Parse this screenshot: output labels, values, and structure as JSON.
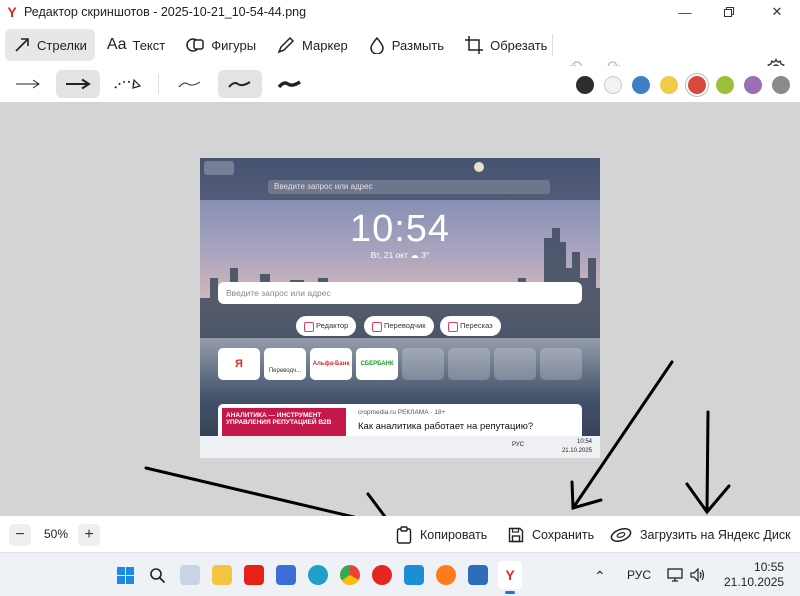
{
  "window": {
    "title": "Редактор скриншотов - 2025-10-21_10-54-44.png",
    "logo": "Y",
    "controls": [
      "minimize-icon",
      "maximize-icon",
      "close-icon"
    ]
  },
  "toolbar": {
    "tools": [
      {
        "label": "Стрелки",
        "icon": "arrow-tool-icon",
        "active": true
      },
      {
        "label": "Текст",
        "icon": "text-tool-icon",
        "active": false
      },
      {
        "label": "Фигуры",
        "icon": "shapes-tool-icon",
        "active": false
      },
      {
        "label": "Маркер",
        "icon": "marker-tool-icon",
        "active": false
      },
      {
        "label": "Размыть",
        "icon": "blur-tool-icon",
        "active": false
      },
      {
        "label": "Обрезать",
        "icon": "crop-tool-icon",
        "active": false
      }
    ],
    "text_icon_glyph": "Aa"
  },
  "subbar": {
    "arrow_styles": [
      "thin-arrow-icon",
      "thick-arrow-icon",
      "dotted-arrow-icon"
    ],
    "stroke_widths": [
      "thin-stroke-icon",
      "medium-stroke-icon",
      "thick-stroke-icon"
    ],
    "colors": [
      "#2d2d2d",
      "#f2f2f2",
      "#3f7fc4",
      "#f2cb4a",
      "#d9493f",
      "#9bc13a",
      "#9a6fb4",
      "#8a8a8a"
    ],
    "selected_color": "#d9493f"
  },
  "screenshot": {
    "address_placeholder": "Введите запрос или адрес",
    "time": "10:54",
    "date_weather": "Вт, 21 окт   ☁ 3°",
    "search_placeholder": "Введите запрос или адрес",
    "chips": [
      "Редактор",
      "Переводчик",
      "Пересказ"
    ],
    "tiles": [
      "Я",
      "Переводч...",
      "Альфа-Банк",
      "СБЕРБАНК"
    ],
    "news_ad": "АНАЛИТИКА — ИНСТРУМЕНТ УПРАВЛЕНИЯ РЕПУТАЦИЕЙ B2B",
    "news_source": "cropmedia.ru  РЕКЛАМА · 18+",
    "news_headline": "Как аналитика работает на репутацию?",
    "inner_tray": "РУС",
    "inner_time": "10:54",
    "inner_date": "21.10.2025"
  },
  "bottom": {
    "zoom": "50%",
    "zoom_out": "−",
    "zoom_in": "+",
    "copy": "Копировать",
    "save": "Сохранить",
    "upload": "Загрузить на Яндекс Диск"
  },
  "taskbar": {
    "language": "РУС",
    "time": "10:55",
    "date": "21.10.2025"
  }
}
